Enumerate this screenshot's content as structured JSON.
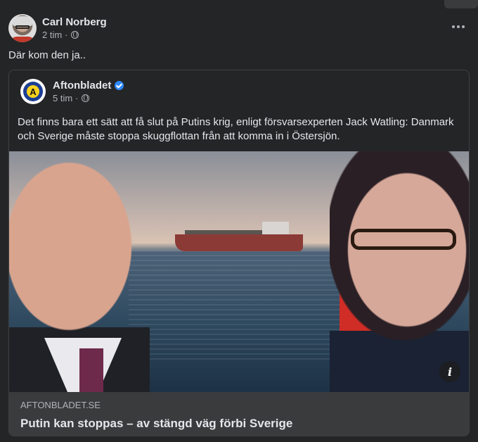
{
  "post": {
    "author": "Carl Norberg",
    "time": "2 tim",
    "separator": "·",
    "text": "Där kom den ja..",
    "more_icon": "more-horizontal-icon",
    "audience_icon": "globe-icon"
  },
  "shared": {
    "page_name": "Aftonbladet",
    "logo_letter": "A",
    "verified_icon": "verified-badge-icon",
    "time": "5 tim",
    "separator": "·",
    "text": "Det finns bara ett sätt att få slut på Putins krig, enligt försvarsexperten Jack Watling: Danmark och Sverige måste stoppa skuggflottan från att komma in i Östersjön.",
    "link_domain": "AFTONBLADET.SE",
    "link_title": "Putin kan stoppas – av stängd väg förbi Sverige",
    "info_label": "i"
  },
  "colors": {
    "background": "#242526",
    "link_footer": "#3a3b3c",
    "verified": "#2d88ff",
    "logo_blue": "#1c3f94",
    "logo_yellow": "#f6d21e"
  }
}
